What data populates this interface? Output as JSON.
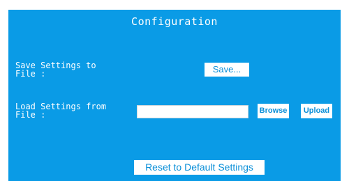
{
  "panel": {
    "title": "Configuration",
    "background_color": "#0a9be6"
  },
  "save": {
    "label": "Save Settings to\nFile :",
    "button_label": "Save..."
  },
  "load": {
    "label": "Load Settings from\nFile :",
    "file_input_value": "",
    "browse_label": "Browse",
    "upload_label": "Upload"
  },
  "reset": {
    "button_label": "Reset to Default Settings"
  }
}
